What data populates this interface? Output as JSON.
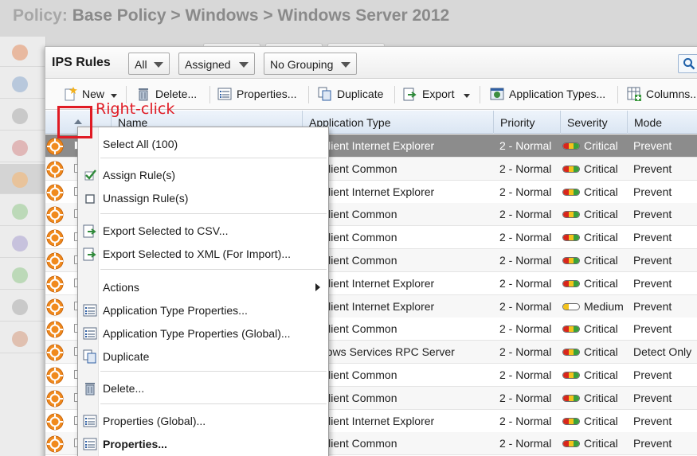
{
  "page_title": {
    "label": "Policy:",
    "path": "Base Policy > Windows > Windows Server 2012"
  },
  "window": {
    "title": "IPS Rules"
  },
  "filters": {
    "scope": "All",
    "assignment": "Assigned",
    "grouping": "No Grouping"
  },
  "toolbar": {
    "new": "New",
    "delete": "Delete...",
    "properties": "Properties...",
    "duplicate": "Duplicate",
    "export": "Export",
    "application_types": "Application Types...",
    "columns": "Columns..."
  },
  "columns": [
    "Name",
    "Application Type",
    "Priority",
    "Severity",
    "Mode"
  ],
  "rows": [
    {
      "app_type": "Client Internet Explorer",
      "priority": "2 - Normal",
      "severity": "Critical",
      "mode": "Prevent",
      "selected": true
    },
    {
      "app_type": "Client Common",
      "priority": "2 - Normal",
      "severity": "Critical",
      "mode": "Prevent"
    },
    {
      "app_type": "Client Internet Explorer",
      "priority": "2 - Normal",
      "severity": "Critical",
      "mode": "Prevent"
    },
    {
      "app_type": "Client Common",
      "priority": "2 - Normal",
      "severity": "Critical",
      "mode": "Prevent"
    },
    {
      "app_type": "Client Common",
      "priority": "2 - Normal",
      "severity": "Critical",
      "mode": "Prevent"
    },
    {
      "app_type": "Client Common",
      "priority": "2 - Normal",
      "severity": "Critical",
      "mode": "Prevent"
    },
    {
      "app_type": "Client Internet Explorer",
      "priority": "2 - Normal",
      "severity": "Critical",
      "mode": "Prevent"
    },
    {
      "app_type": "Client Internet Explorer",
      "priority": "2 - Normal",
      "severity": "Medium",
      "mode": "Prevent"
    },
    {
      "app_type": "Client Common",
      "priority": "2 - Normal",
      "severity": "Critical",
      "mode": "Prevent"
    },
    {
      "app_type": "dows Services RPC Server",
      "priority": "2 - Normal",
      "severity": "Critical",
      "mode": "Detect Only"
    },
    {
      "app_type": "Client Common",
      "priority": "2 - Normal",
      "severity": "Critical",
      "mode": "Prevent"
    },
    {
      "app_type": "Client Common",
      "priority": "2 - Normal",
      "severity": "Critical",
      "mode": "Prevent"
    },
    {
      "app_type": "Client Internet Explorer",
      "priority": "2 - Normal",
      "severity": "Critical",
      "mode": "Prevent"
    },
    {
      "app_type": "Client Common",
      "priority": "2 - Normal",
      "severity": "Critical",
      "mode": "Prevent"
    }
  ],
  "context_menu": {
    "select_all": "Select All (100)",
    "assign": "Assign Rule(s)",
    "unassign": "Unassign Rule(s)",
    "export_csv": "Export Selected to CSV...",
    "export_xml": "Export Selected to XML (For Import)...",
    "actions": "Actions",
    "app_type_props": "Application Type Properties...",
    "app_type_props_global": "Application Type Properties (Global)...",
    "duplicate": "Duplicate",
    "delete": "Delete...",
    "properties_global": "Properties (Global)...",
    "properties": "Properties..."
  },
  "annotation": {
    "text": "Right-click"
  },
  "colors": {
    "annotation": "#e01b24",
    "header": "#dbe6f3",
    "selected_row": "#8c8c8c"
  }
}
